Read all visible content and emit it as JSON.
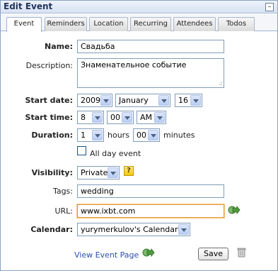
{
  "header": {
    "title": "Edit Event",
    "collapse_label": "–"
  },
  "tabs": [
    {
      "label": "Event"
    },
    {
      "label": "Reminders"
    },
    {
      "label": "Location"
    },
    {
      "label": "Recurring"
    },
    {
      "label": "Attendees"
    },
    {
      "label": "Todos"
    }
  ],
  "form": {
    "name": {
      "label": "Name:",
      "value": "Свадьба"
    },
    "description": {
      "label": "Description:",
      "value": "Знаменательное событие"
    },
    "start_date": {
      "label": "Start date:",
      "year": "2009",
      "month": "January",
      "day": "16"
    },
    "start_time": {
      "label": "Start time:",
      "hour": "8",
      "minute": "00",
      "ampm": "AM"
    },
    "duration": {
      "label": "Duration:",
      "hours": "1",
      "hours_unit": "hours",
      "minutes": "00",
      "minutes_unit": "minutes"
    },
    "all_day": {
      "label": "All day event",
      "checked": false
    },
    "visibility": {
      "label": "Visibility:",
      "value": "Private",
      "help": "?"
    },
    "tags": {
      "label": "Tags:",
      "value": "wedding"
    },
    "url": {
      "label": "URL:",
      "value": "www.ixbt.com"
    },
    "calendar": {
      "label": "Calendar:",
      "value": "yurymerkulov's Calendar"
    }
  },
  "footer": {
    "view_link": "View Event Page",
    "save_label": "Save"
  },
  "colors": {
    "accent_link": "#2a4fb0",
    "focus_border": "#e59a3c",
    "help_icon": "#f5c60a",
    "go_icon": "#3c8a3c"
  }
}
